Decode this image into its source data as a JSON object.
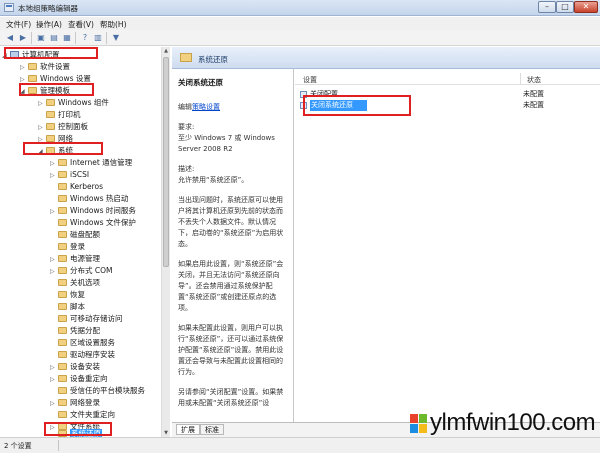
{
  "window": {
    "title": "本地组策略编辑器",
    "buttons": [
      "–",
      "□",
      "✕"
    ]
  },
  "menu": [
    "文件(F)",
    "操作(A)",
    "查看(V)",
    "帮助(H)"
  ],
  "tree": {
    "items": [
      {
        "label": "计算机配置",
        "expander": "◢",
        "icon": "computer-icon"
      },
      {
        "label": "软件设置",
        "expander": "▷",
        "icon": "folder-icon"
      },
      {
        "label": "Windows 设置",
        "expander": "▷",
        "icon": "folder-icon"
      },
      {
        "label": "管理模板",
        "expander": "◢",
        "icon": "folder-icon"
      },
      {
        "label": "Windows 组件",
        "expander": "▷",
        "icon": "folder-icon"
      },
      {
        "label": "打印机",
        "expander": "",
        "icon": "folder-icon"
      },
      {
        "label": "控制面板",
        "expander": "▷",
        "icon": "folder-icon"
      },
      {
        "label": "网络",
        "expander": "▷",
        "icon": "folder-icon"
      },
      {
        "label": "系统",
        "expander": "◢",
        "icon": "folder-icon"
      },
      {
        "label": "Internet 通信管理",
        "expander": "▷",
        "icon": "folder-icon"
      },
      {
        "label": "iSCSI",
        "expander": "▷",
        "icon": "folder-icon"
      },
      {
        "label": "Kerberos",
        "expander": "",
        "icon": "folder-icon"
      },
      {
        "label": "Windows 热启动",
        "expander": "",
        "icon": "folder-icon"
      },
      {
        "label": "Windows 时间服务",
        "expander": "▷",
        "icon": "folder-icon"
      },
      {
        "label": "Windows 文件保护",
        "expander": "",
        "icon": "folder-icon"
      },
      {
        "label": "磁盘配额",
        "expander": "",
        "icon": "folder-icon"
      },
      {
        "label": "登录",
        "expander": "",
        "icon": "folder-icon"
      },
      {
        "label": "电源管理",
        "expander": "▷",
        "icon": "folder-icon"
      },
      {
        "label": "分布式 COM",
        "expander": "▷",
        "icon": "folder-icon"
      },
      {
        "label": "关机选项",
        "expander": "",
        "icon": "folder-icon"
      },
      {
        "label": "恢复",
        "expander": "",
        "icon": "folder-icon"
      },
      {
        "label": "脚本",
        "expander": "",
        "icon": "folder-icon"
      },
      {
        "label": "可移动存储访问",
        "expander": "",
        "icon": "folder-icon"
      },
      {
        "label": "凭据分配",
        "expander": "",
        "icon": "folder-icon"
      },
      {
        "label": "区域设置服务",
        "expander": "",
        "icon": "folder-icon"
      },
      {
        "label": "驱动程序安装",
        "expander": "",
        "icon": "folder-icon"
      },
      {
        "label": "设备安装",
        "expander": "▷",
        "icon": "folder-icon"
      },
      {
        "label": "设备重定向",
        "expander": "▷",
        "icon": "folder-icon"
      },
      {
        "label": "受信任的平台模块服务",
        "expander": "",
        "icon": "folder-icon"
      },
      {
        "label": "网络登录",
        "expander": "▷",
        "icon": "folder-icon"
      },
      {
        "label": "文件夹重定向",
        "expander": "",
        "icon": "folder-icon"
      },
      {
        "label": "文件系统",
        "expander": "▷",
        "icon": "folder-icon"
      },
      {
        "label": "系统还原",
        "expander": "",
        "icon": "folder-icon"
      }
    ]
  },
  "right": {
    "header_title": "系统还原",
    "description": {
      "heading": "关闭系统还原",
      "edit_prefix": "编辑",
      "edit_link": "策略设置",
      "requirements": "要求:\n至少 Windows 7 或 Windows Server 2008 R2",
      "description_label": "描述:\n允许禁用“系统还原”。",
      "para1": "当出现问题时，系统还原可以使用户将其计算机还原到先前的状态而不丢失个人数据文件。默认情况下，启动卷的“系统还原”为启用状态。",
      "para2": "如果启用此设置，则“系统还原”会关闭，并且无法访问“系统还原向导”。还会禁用通过系统保护配置“系统还原”或创建还原点的选项。",
      "para3": "如果未配置此设置，则用户可以执行“系统还原”，还可以通过系统保护配置“系统还原”设置。禁用此设置还会导致与未配置此设置相同的行为。",
      "para4": "另请参阅“关闭配置”设置。如果禁用或未配置“关闭系统还原”设"
    },
    "columns": {
      "setting": "设置",
      "state": "状态"
    },
    "rows": [
      {
        "name": "关闭配置",
        "state": "未配置"
      },
      {
        "name": "关闭系统还原",
        "state": "未配置"
      }
    ],
    "tabs": [
      "扩展",
      "标准"
    ]
  },
  "status": {
    "text": "2 个设置"
  },
  "watermark": {
    "text": "ylmfwin100.com"
  },
  "colors": {
    "highlight": "#e02020",
    "selection": "#3399ff",
    "link": "#0044cc"
  }
}
